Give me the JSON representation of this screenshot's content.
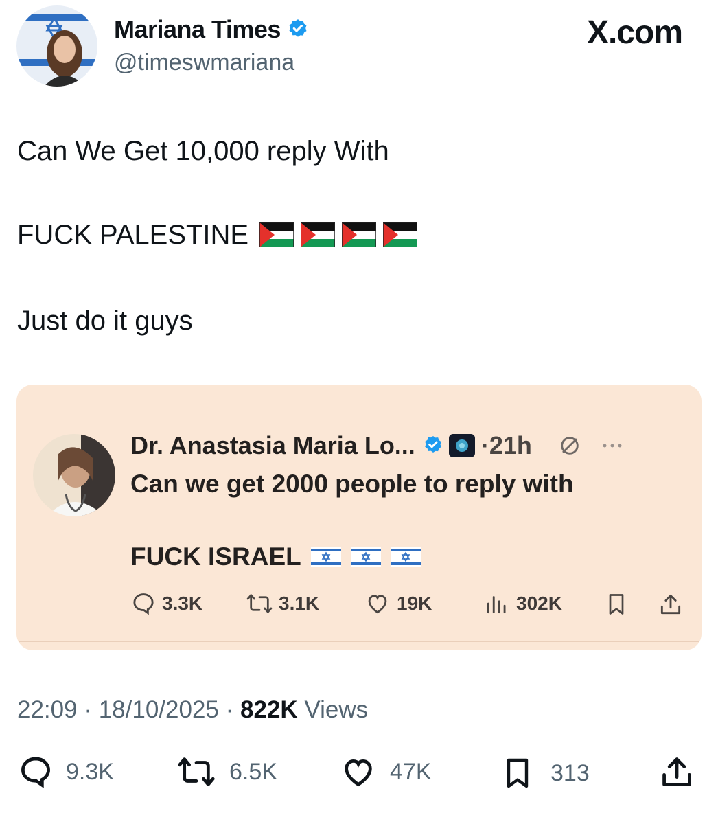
{
  "tweet": {
    "author_name": "Mariana Times",
    "author_handle": "@timeswmariana",
    "brand": "X.com",
    "text_line1": "Can We Get 10,000 reply With",
    "text_line2": "FUCK PALESTINE",
    "text_line3": "Just do it guys",
    "time": "22:09",
    "date": "18/10/2025",
    "views_count": "822K",
    "views_label": "Views",
    "stats": {
      "replies": "9.3K",
      "reposts": "6.5K",
      "likes": "47K",
      "bookmarks": "313"
    }
  },
  "quoted": {
    "author_name": "Dr. Anastasia Maria Lo...",
    "time": "21h",
    "text_line1": "Can we get 2000 people to reply with",
    "text_line2": "FUCK ISRAEL",
    "stats": {
      "replies": "3.3K",
      "reposts": "3.1K",
      "likes": "19K",
      "views": "302K"
    }
  },
  "colors": {
    "verified_blue": "#1d9bf0",
    "card_background": "#fbe7d6",
    "secondary_text": "#536471"
  }
}
